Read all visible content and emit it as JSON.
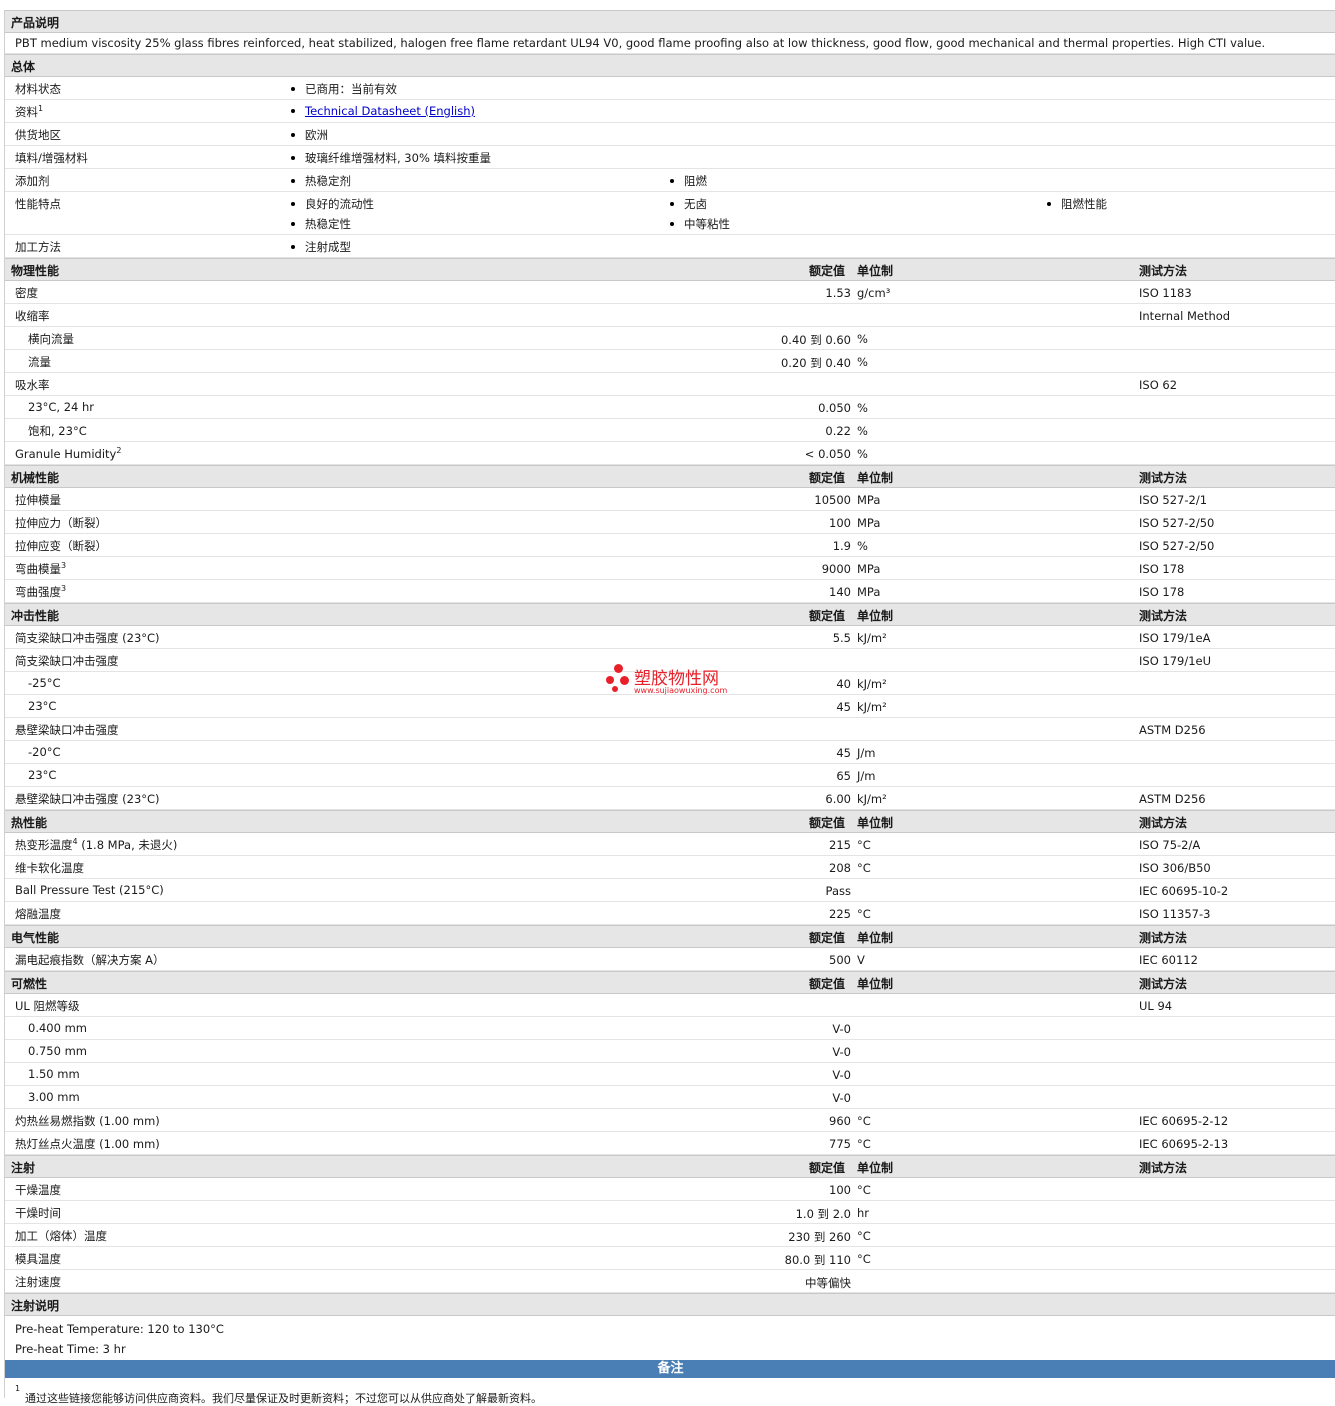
{
  "headers": {
    "rated": "额定值",
    "unit": "单位制",
    "test": "测试方法"
  },
  "desc": {
    "title": "产品说明",
    "text": "PBT medium viscosity 25% glass fibres reinforced, heat stabilized, halogen free flame retardant UL94 V0, good flame proofing also at low thickness, good flow, good mechanical and thermal properties. High CTI value."
  },
  "general": {
    "title": "总体",
    "rows": [
      {
        "label": "材料状态",
        "items": [
          "已商用：当前有效"
        ]
      },
      {
        "label": "资料",
        "sup": "1",
        "items": [
          "Technical Datasheet (English)"
        ]
      },
      {
        "label": "供货地区",
        "items": [
          "欧洲"
        ]
      },
      {
        "label": "填料/增强材料",
        "items": [
          "玻璃纤维增强材料, 30% 填料按重量"
        ]
      },
      {
        "label": "添加剂",
        "items": [
          "热稳定剂",
          "阻燃"
        ]
      },
      {
        "label": "性能特点",
        "items": [
          "良好的流动性",
          "无卤",
          "阻燃性能",
          "热稳定性",
          "中等粘性"
        ]
      },
      {
        "label": "加工方法",
        "items": [
          "注射成型"
        ]
      }
    ]
  },
  "physical": {
    "title": "物理性能",
    "rows": [
      {
        "label": "密度",
        "val": "1.53",
        "unit": "g/cm³",
        "test": "ISO 1183"
      },
      {
        "label": "收缩率",
        "val": "",
        "unit": "",
        "test": "Internal Method"
      },
      {
        "label": "横向流量",
        "val": "0.40 到  0.60",
        "unit": "%",
        "test": "",
        "sub": true
      },
      {
        "label": "流量",
        "val": "0.20 到  0.40",
        "unit": "%",
        "test": "",
        "sub": true
      },
      {
        "label": "吸水率",
        "val": "",
        "unit": "",
        "test": "ISO 62"
      },
      {
        "label": "23°C, 24 hr",
        "val": "0.050",
        "unit": "%",
        "test": "",
        "sub": true
      },
      {
        "label": "饱和, 23°C",
        "val": "0.22",
        "unit": "%",
        "test": "",
        "sub": true
      },
      {
        "label": "Granule Humidity",
        "sup": "2",
        "val": "< 0.050",
        "unit": "%",
        "test": ""
      }
    ]
  },
  "mechanical": {
    "title": "机械性能",
    "rows": [
      {
        "label": "拉伸模量",
        "val": "10500",
        "unit": "MPa",
        "test": "ISO 527-2/1"
      },
      {
        "label": "拉伸应力（断裂）",
        "val": "100",
        "unit": "MPa",
        "test": "ISO 527-2/50"
      },
      {
        "label": "拉伸应变（断裂）",
        "val": "1.9",
        "unit": "%",
        "test": "ISO 527-2/50"
      },
      {
        "label": "弯曲模量",
        "sup": "3",
        "val": "9000",
        "unit": "MPa",
        "test": "ISO 178"
      },
      {
        "label": "弯曲强度",
        "sup": "3",
        "val": "140",
        "unit": "MPa",
        "test": "ISO 178"
      }
    ]
  },
  "impact": {
    "title": "冲击性能",
    "rows": [
      {
        "label": "简支梁缺口冲击强度 (23°C)",
        "val": "5.5",
        "unit": "kJ/m²",
        "test": "ISO 179/1eA"
      },
      {
        "label": "简支梁缺口冲击强度",
        "val": "",
        "unit": "",
        "test": "ISO 179/1eU"
      },
      {
        "label": "-25°C",
        "val": "40",
        "unit": "kJ/m²",
        "test": "",
        "sub": true
      },
      {
        "label": "23°C",
        "val": "45",
        "unit": "kJ/m²",
        "test": "",
        "sub": true
      },
      {
        "label": "悬壁梁缺口冲击强度",
        "val": "",
        "unit": "",
        "test": "ASTM D256"
      },
      {
        "label": "-20°C",
        "val": "45",
        "unit": "J/m",
        "test": "",
        "sub": true
      },
      {
        "label": "23°C",
        "val": "65",
        "unit": "J/m",
        "test": "",
        "sub": true
      },
      {
        "label": "悬壁梁缺口冲击强度 (23°C)",
        "val": "6.00",
        "unit": "kJ/m²",
        "test": "ASTM D256"
      }
    ]
  },
  "thermal": {
    "title": "热性能",
    "rows": [
      {
        "label": "热变形温度",
        "sup": "4",
        "label2": " (1.8 MPa, 未退火)",
        "val": "215",
        "unit": "°C",
        "test": "ISO 75-2/A"
      },
      {
        "label": "维卡软化温度",
        "val": "208",
        "unit": "°C",
        "test": "ISO 306/B50"
      },
      {
        "label": "Ball Pressure Test (215°C)",
        "val": "Pass",
        "unit": "",
        "test": "IEC 60695-10-2"
      },
      {
        "label": "熔融温度",
        "val": "225",
        "unit": "°C",
        "test": "ISO 11357-3"
      }
    ]
  },
  "electrical": {
    "title": "电气性能",
    "rows": [
      {
        "label": "漏电起痕指数（解决方案 A）",
        "val": "500",
        "unit": "V",
        "test": "IEC 60112"
      }
    ]
  },
  "flammability": {
    "title": "可燃性",
    "rows": [
      {
        "label": "UL 阻燃等级",
        "val": "",
        "unit": "",
        "test": "UL 94"
      },
      {
        "label": "0.400 mm",
        "val": "V-0",
        "unit": "",
        "test": "",
        "sub": true
      },
      {
        "label": "0.750 mm",
        "val": "V-0",
        "unit": "",
        "test": "",
        "sub": true
      },
      {
        "label": "1.50 mm",
        "val": "V-0",
        "unit": "",
        "test": "",
        "sub": true
      },
      {
        "label": "3.00 mm",
        "val": "V-0",
        "unit": "",
        "test": "",
        "sub": true
      },
      {
        "label": "灼热丝易燃指数 (1.00 mm)",
        "val": "960",
        "unit": "°C",
        "test": "IEC 60695-2-12"
      },
      {
        "label": "热灯丝点火温度 (1.00 mm)",
        "val": "775",
        "unit": "°C",
        "test": "IEC 60695-2-13"
      }
    ]
  },
  "injection": {
    "title": "注射",
    "rows": [
      {
        "label": "干燥温度",
        "val": "100",
        "unit": "°C",
        "test": ""
      },
      {
        "label": "干燥时间",
        "val": "1.0 到  2.0",
        "unit": "hr",
        "test": ""
      },
      {
        "label": "加工（熔体）温度",
        "val": "230 到  260",
        "unit": "°C",
        "test": ""
      },
      {
        "label": "模具温度",
        "val": "80.0 到  110",
        "unit": "°C",
        "test": ""
      },
      {
        "label": "注射速度",
        "val": "中等偏快",
        "unit": "",
        "test": "",
        "valAt": "unit"
      }
    ]
  },
  "injection_notes": {
    "title": "注射说明",
    "lines": [
      "Pre-heat Temperature: 120 to 130°C",
      "Pre-heat Time: 3 hr"
    ]
  },
  "remarks": {
    "title": "备注",
    "footnote": "通过这些链接您能够访问供应商资料。我们尽量保证及时更新资料；不过您可以从供应商处了解最新资料。",
    "footnote_sup": "1"
  },
  "watermark": {
    "name": "塑胶物性网",
    "url": "www.sujiaowuxing.com"
  }
}
